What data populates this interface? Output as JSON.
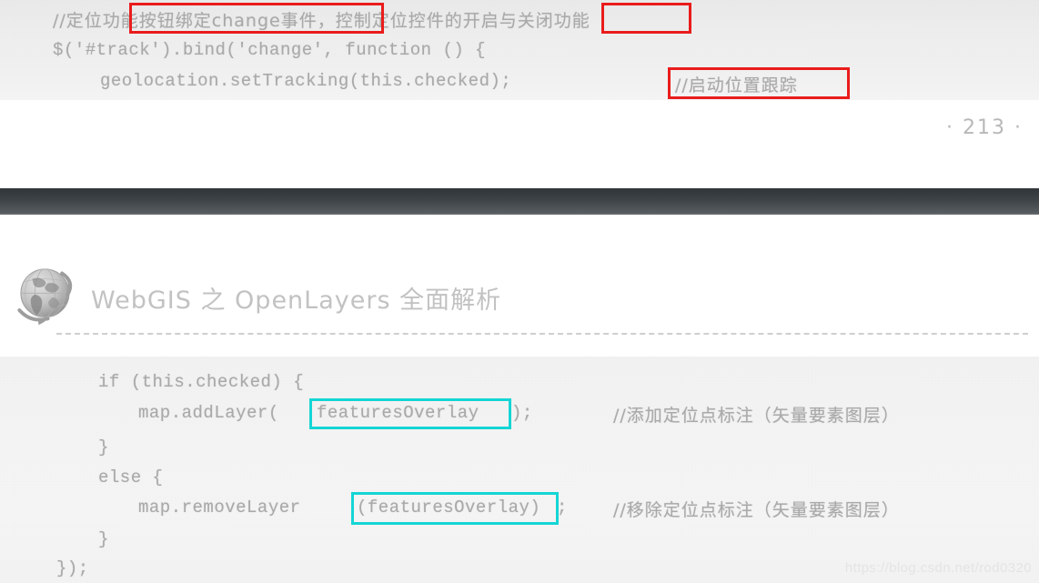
{
  "document": {
    "page_number": "· 213 ·",
    "watermark": "https://blog.csdn.net/rod0320"
  },
  "running_header": {
    "icon": "globe-icon",
    "title": "WebGIS 之 OpenLayers 全面解析"
  },
  "top_code_block": {
    "lines": [
      {
        "id": "l1",
        "text": "//定位功能按钮绑定change事件，控制定位控件的开启与关闭功能"
      },
      {
        "id": "l2",
        "text": "$('#track').bind('change', function () {"
      },
      {
        "id": "l3",
        "text": "geolocation.setTracking(this.checked);"
      },
      {
        "id": "l3c",
        "text": "//启动位置跟踪"
      }
    ]
  },
  "bottom_code_block": {
    "lines": [
      {
        "id": "b1",
        "text": "if (this.checked) {"
      },
      {
        "id": "b2a",
        "text": "map.addLayer("
      },
      {
        "id": "b2b",
        "text": "featuresOverlay"
      },
      {
        "id": "b2c",
        "text": ");"
      },
      {
        "id": "b2d",
        "text": "//添加定位点标注（矢量要素图层）"
      },
      {
        "id": "b3",
        "text": "}"
      },
      {
        "id": "b4",
        "text": "else {"
      },
      {
        "id": "b5a",
        "text": "map.removeLayer"
      },
      {
        "id": "b5b",
        "text": "(featuresOverlay)"
      },
      {
        "id": "b5c",
        "text": ";"
      },
      {
        "id": "b5d",
        "text": "//移除定位点标注（矢量要素图层）"
      },
      {
        "id": "b6",
        "text": "}"
      },
      {
        "id": "b7",
        "text": "});"
      }
    ]
  },
  "annotations": {
    "red_color": "#ea1c1c",
    "cyan_color": "#15d5d5",
    "boxes": [
      {
        "name": "red-box-change-event",
        "color": "red"
      },
      {
        "name": "red-box-open-close",
        "color": "red"
      },
      {
        "name": "red-box-start-tracking",
        "color": "red"
      },
      {
        "name": "cyan-box-add-overlay",
        "color": "cyan"
      },
      {
        "name": "cyan-box-remove-overlay",
        "color": "cyan"
      }
    ]
  }
}
